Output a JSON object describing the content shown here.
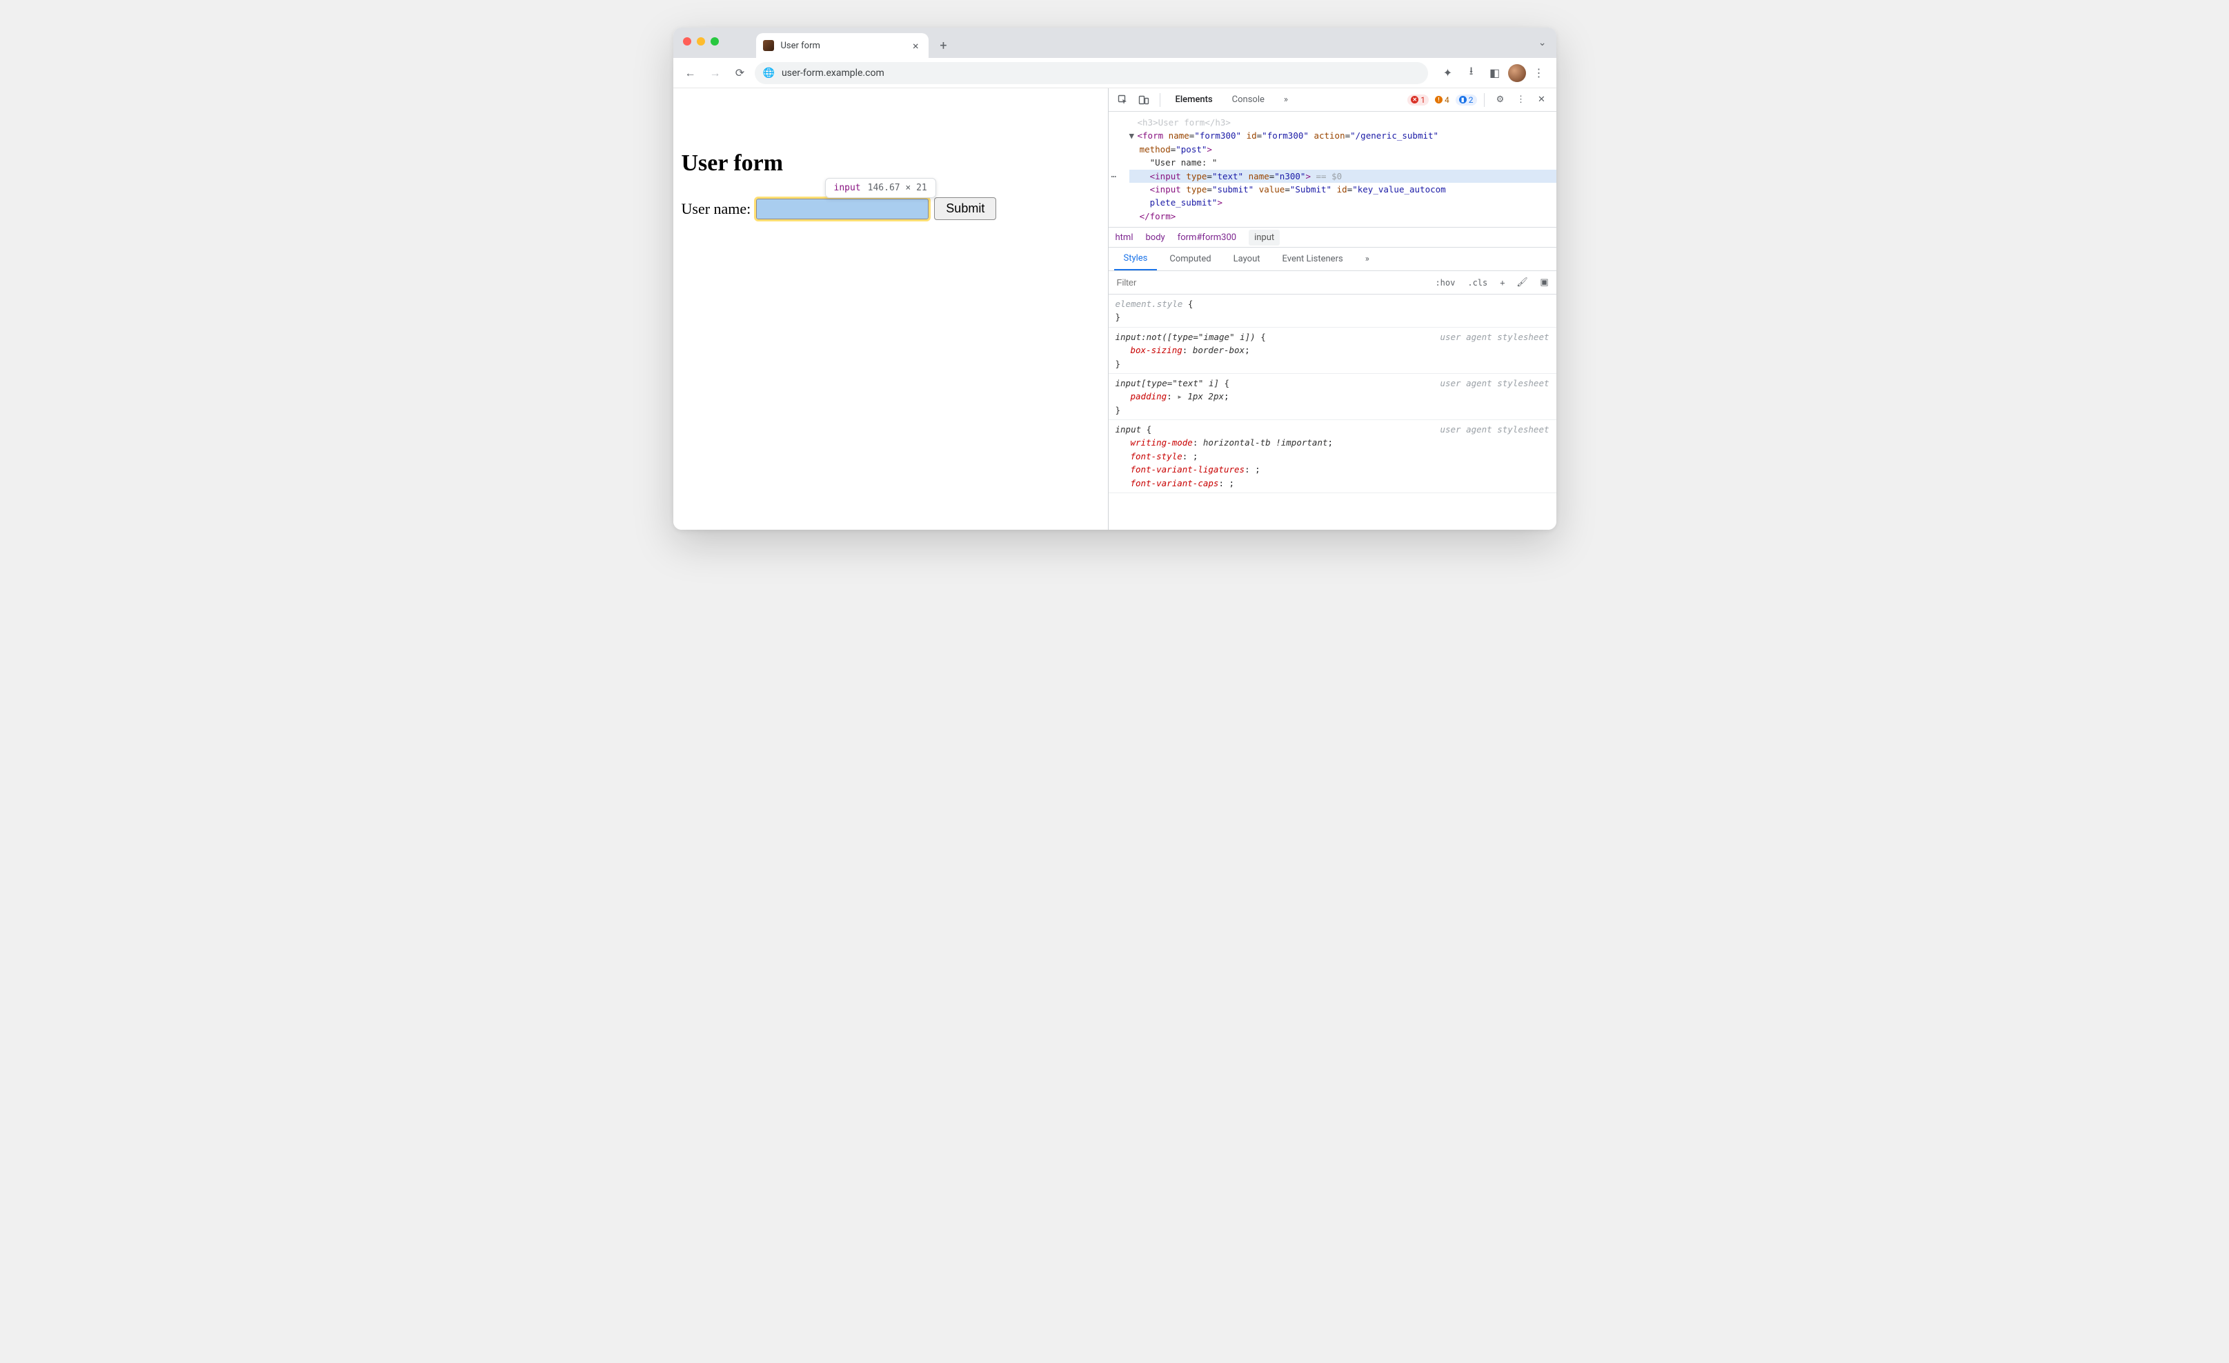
{
  "browser": {
    "tab_title": "User form",
    "url": "user-form.example.com"
  },
  "page": {
    "heading": "User form",
    "label": "User name:",
    "submit_label": "Submit"
  },
  "inspect_tooltip": {
    "tag": "input",
    "dimensions": "146.67 × 21"
  },
  "devtools": {
    "tabs": {
      "elements": "Elements",
      "console": "Console",
      "more": "»"
    },
    "counts": {
      "errors": "1",
      "warnings": "4",
      "info": "2"
    },
    "dom": {
      "line0": "<h3>User form</h3>",
      "form_open_1": "<form name=\"form300\" id=\"form300\" action=\"/generic_submit\"",
      "form_open_2": "method=\"post\">",
      "text_node": "\"User name: \"",
      "selected": "<input type=\"text\" name=\"n300\">",
      "selected_suffix": " == $0",
      "submit_input_1": "<input type=\"submit\" value=\"Submit\" id=\"key_value_autocom",
      "submit_input_2": "plete_submit\">",
      "form_close": "</form>"
    },
    "breadcrumb": [
      "html",
      "body",
      "form#form300",
      "input"
    ],
    "styles_tabs": {
      "styles": "Styles",
      "computed": "Computed",
      "layout": "Layout",
      "listeners": "Event Listeners",
      "more": "»"
    },
    "styles_toolbar": {
      "filter_placeholder": "Filter",
      "hov": ":hov",
      "cls": ".cls",
      "plus": "+"
    },
    "rules": {
      "ua_label": "user agent stylesheet",
      "r0": {
        "sel": "element.style",
        "open": " {",
        "close": "}"
      },
      "r1": {
        "sel": "input:not([type=\"image\" i])",
        "open": " {",
        "prop": "box-sizing",
        "val": "border-box",
        "close": "}"
      },
      "r2": {
        "sel": "input[type=\"text\" i]",
        "open": " {",
        "prop": "padding",
        "val": "1px 2px",
        "close": "}"
      },
      "r3": {
        "sel": "input",
        "open": " {",
        "p1": "writing-mode",
        "v1": "horizontal-tb !important",
        "p2": "font-style",
        "v2": "",
        "p3": "font-variant-ligatures",
        "v3": "",
        "p4": "font-variant-caps",
        "v4": ""
      }
    }
  }
}
